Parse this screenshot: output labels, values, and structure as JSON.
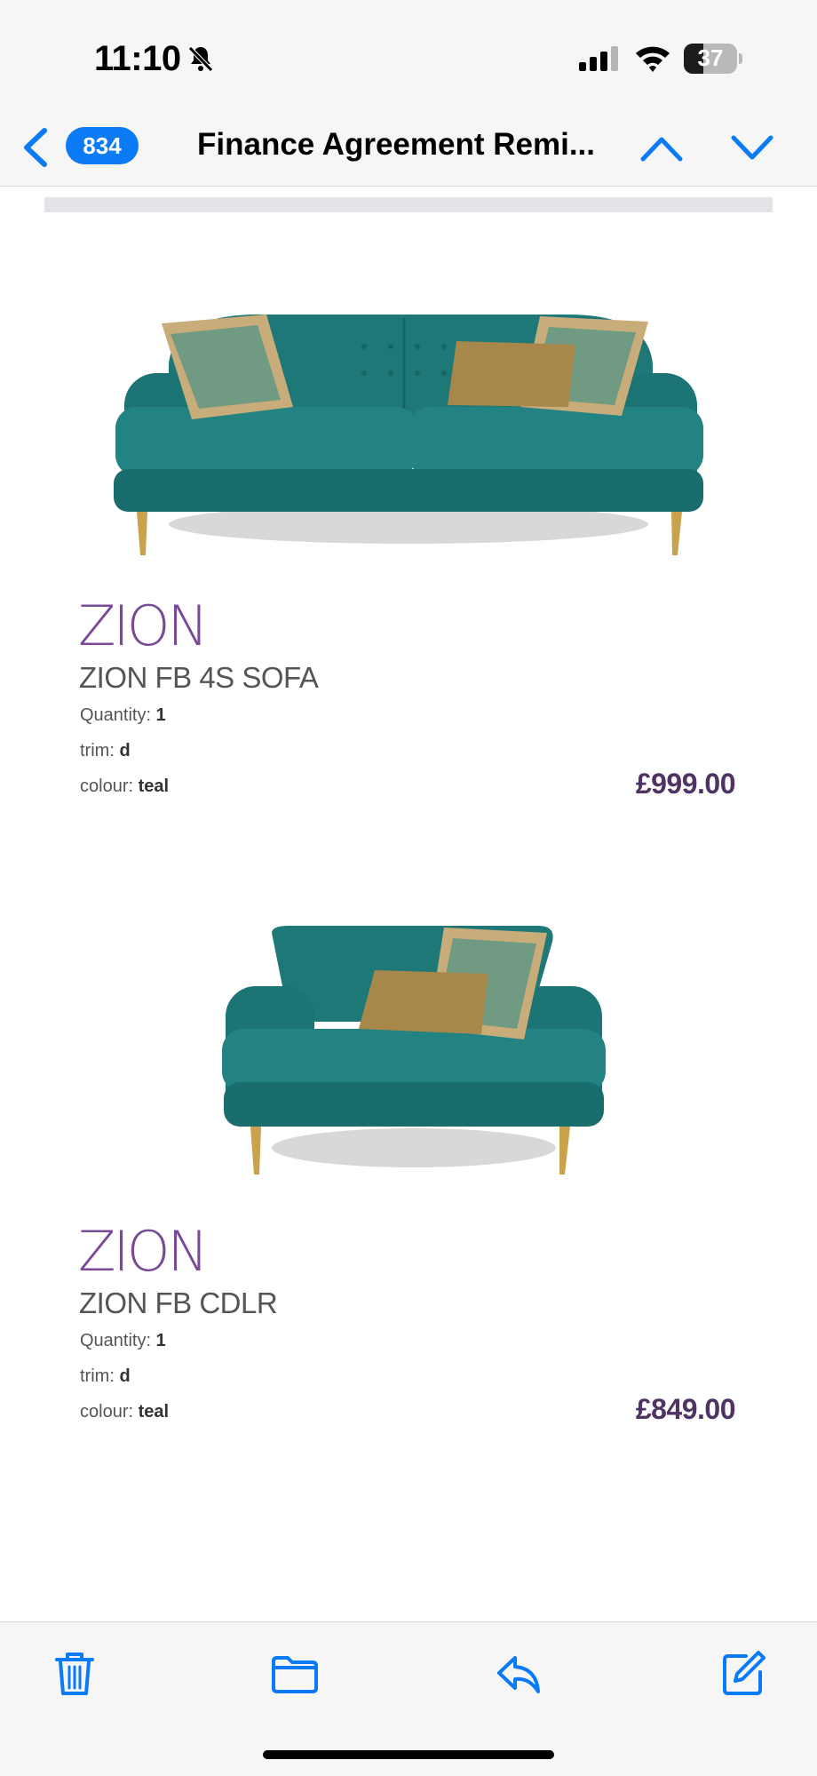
{
  "status_bar": {
    "time": "11:10",
    "battery_level": "37",
    "battery_fraction": 0.37
  },
  "nav": {
    "unread_count": "834",
    "title": "Finance Agreement Remi..."
  },
  "products": [
    {
      "brand": "ZION",
      "name": "ZION FB 4S SOFA",
      "quantity_label": "Quantity: ",
      "quantity": "1",
      "trim_label": "trim: ",
      "trim": "d",
      "colour_label": "colour: ",
      "colour": "teal",
      "price": "£999.00"
    },
    {
      "brand": "ZION",
      "name": "ZION FB CDLR",
      "quantity_label": "Quantity: ",
      "quantity": "1",
      "trim_label": "trim: ",
      "trim": "d",
      "colour_label": "colour: ",
      "colour": "teal",
      "price": "£849.00"
    }
  ],
  "colors": {
    "accent": "#0a7af5",
    "brand_purple": "#7a4a9a",
    "price_purple": "#4f3364",
    "sofa_teal": "#1f7f7f"
  },
  "toolbar": {
    "icons": [
      "trash-icon",
      "folder-icon",
      "reply-icon",
      "compose-icon"
    ]
  }
}
